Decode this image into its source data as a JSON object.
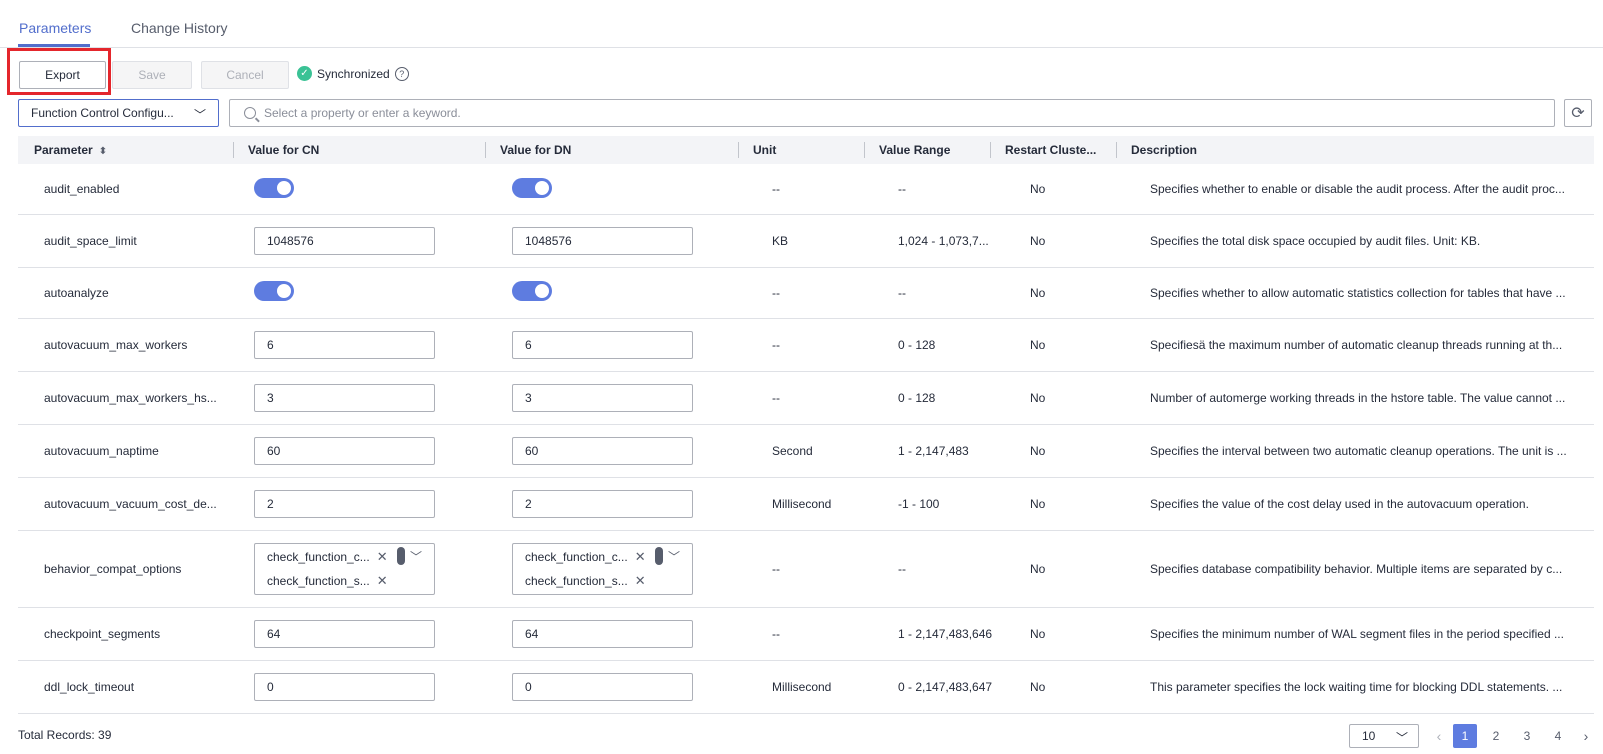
{
  "tabs": [
    {
      "label": "Parameters",
      "active": true
    },
    {
      "label": "Change History",
      "active": false
    }
  ],
  "toolbar": {
    "export_label": "Export",
    "save_label": "Save",
    "cancel_label": "Cancel",
    "status_label": "Synchronized",
    "help_glyph": "?"
  },
  "filter": {
    "category_value": "Function Control Configu...",
    "search_placeholder": "Select a property or enter a keyword."
  },
  "table": {
    "headers": [
      "Parameter",
      "Value for CN",
      "Value for DN",
      "Unit",
      "Value Range",
      "Restart Cluste...",
      "Description"
    ],
    "rows": [
      {
        "param": "audit_enabled",
        "type": "toggle",
        "cn": "on",
        "dn": "on",
        "unit": "--",
        "range": "--",
        "restart": "No",
        "desc": "Specifies whether to enable or disable the audit process. After the audit proc..."
      },
      {
        "param": "audit_space_limit",
        "type": "input",
        "cn": "1048576",
        "dn": "1048576",
        "unit": "KB",
        "range": "1,024 - 1,073,7...",
        "restart": "No",
        "desc": "Specifies the total disk space occupied by audit files. Unit: KB."
      },
      {
        "param": "autoanalyze",
        "type": "toggle",
        "cn": "on",
        "dn": "on",
        "unit": "--",
        "range": "--",
        "restart": "No",
        "desc": "Specifies whether to allow automatic statistics collection for tables that have ..."
      },
      {
        "param": "autovacuum_max_workers",
        "type": "input",
        "cn": "6",
        "dn": "6",
        "unit": "--",
        "range": "0 - 128",
        "restart": "No",
        "desc": "Specifiesä the maximum number of automatic cleanup threads running at th..."
      },
      {
        "param": "autovacuum_max_workers_hs...",
        "type": "input",
        "cn": "3",
        "dn": "3",
        "unit": "--",
        "range": "0 - 128",
        "restart": "No",
        "desc": "Number of automerge working threads in the hstore table. The value cannot ..."
      },
      {
        "param": "autovacuum_naptime",
        "type": "input",
        "cn": "60",
        "dn": "60",
        "unit": "Second",
        "range": "1 - 2,147,483",
        "restart": "No",
        "desc": "Specifies the interval between two automatic cleanup operations. The unit is ..."
      },
      {
        "param": "autovacuum_vacuum_cost_de...",
        "type": "input",
        "cn": "2",
        "dn": "2",
        "unit": "Millisecond",
        "range": "-1 - 100",
        "restart": "No",
        "desc": "Specifies the value of the cost delay used in the autovacuum operation."
      },
      {
        "param": "behavior_compat_options",
        "type": "multi",
        "cn": [
          "check_function_c...",
          "check_function_s..."
        ],
        "dn": [
          "check_function_c...",
          "check_function_s..."
        ],
        "unit": "--",
        "range": "--",
        "restart": "No",
        "desc": "Specifies database compatibility behavior. Multiple items are separated by c..."
      },
      {
        "param": "checkpoint_segments",
        "type": "input",
        "cn": "64",
        "dn": "64",
        "unit": "--",
        "range": "1 - 2,147,483,646",
        "restart": "No",
        "desc": "Specifies the minimum number of WAL segment files in the period specified ..."
      },
      {
        "param": "ddl_lock_timeout",
        "type": "input",
        "cn": "0",
        "dn": "0",
        "unit": "Millisecond",
        "range": "0 - 2,147,483,647",
        "restart": "No",
        "desc": "This parameter specifies the lock waiting time for blocking DDL statements. ..."
      }
    ]
  },
  "footer": {
    "total_label": "Total Records: 39",
    "page_size": "10",
    "pages": [
      "1",
      "2",
      "3",
      "4"
    ],
    "current_page": "1",
    "prev_glyph": "‹",
    "next_glyph": "›"
  },
  "colors": {
    "accent": "#5e7ce0",
    "export_highlight": "#e4262c",
    "sync_ok": "#3ac295"
  }
}
